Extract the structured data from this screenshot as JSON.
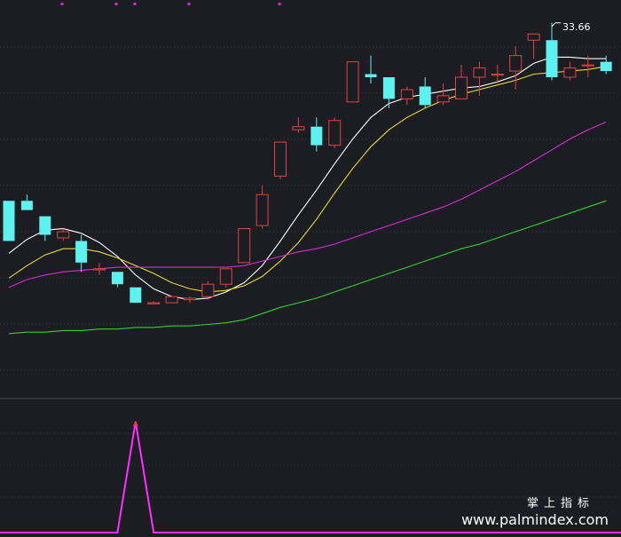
{
  "watermark": {
    "cn": "掌上指标",
    "url": "www.palmindex.com"
  },
  "colors": {
    "background": "#1c1d22",
    "grid": "#30323a",
    "up_candle": "#e0433f",
    "down_candle": "#5ff0f0",
    "ma_short": "#ffffff",
    "ma_mid": "#e6d833",
    "ma_long": "#d32bd3",
    "ma_longest": "#2fd12f",
    "indicator": "#ff30ff",
    "top_marker": "#e01ee0"
  },
  "chart_data": [
    {
      "type": "candlestick",
      "title": "",
      "xlabel": "",
      "ylabel": "",
      "ylim": [
        21.5,
        34.4
      ],
      "grid": true,
      "annotations": [
        {
          "text": "33.66",
          "index": 30,
          "value": 33.66
        }
      ],
      "candles": [
        {
          "o": 27.9,
          "h": 27.9,
          "c": 26.6,
          "l": 26.6
        },
        {
          "o": 27.9,
          "h": 28.1,
          "c": 27.6,
          "l": 27.6
        },
        {
          "o": 27.4,
          "h": 27.4,
          "c": 26.8,
          "l": 26.6
        },
        {
          "o": 26.7,
          "h": 27.0,
          "c": 26.9,
          "l": 26.6
        },
        {
          "o": 26.6,
          "h": 26.8,
          "c": 25.9,
          "l": 25.6
        },
        {
          "o": 25.7,
          "h": 25.9,
          "c": 25.7,
          "l": 25.5
        },
        {
          "o": 25.6,
          "h": 25.6,
          "c": 25.2,
          "l": 25.1
        },
        {
          "o": 25.1,
          "h": 25.1,
          "c": 24.6,
          "l": 24.6
        },
        {
          "o": 24.6,
          "h": 24.65,
          "c": 24.6,
          "l": 24.55
        },
        {
          "o": 24.6,
          "h": 24.8,
          "c": 24.8,
          "l": 24.6
        },
        {
          "o": 24.7,
          "h": 24.8,
          "c": 24.75,
          "l": 24.6
        },
        {
          "o": 24.8,
          "h": 25.3,
          "c": 25.2,
          "l": 24.7
        },
        {
          "o": 25.2,
          "h": 25.7,
          "c": 25.7,
          "l": 25.1
        },
        {
          "o": 25.9,
          "h": 27.0,
          "c": 27.0,
          "l": 25.9
        },
        {
          "o": 27.1,
          "h": 28.4,
          "c": 28.1,
          "l": 27.0
        },
        {
          "o": 28.7,
          "h": 29.8,
          "c": 29.8,
          "l": 28.6
        },
        {
          "o": 30.2,
          "h": 30.6,
          "c": 30.3,
          "l": 30.1
        },
        {
          "o": 30.3,
          "h": 30.6,
          "c": 29.7,
          "l": 29.5
        },
        {
          "o": 29.7,
          "h": 30.6,
          "c": 30.5,
          "l": 29.6
        },
        {
          "o": 31.1,
          "h": 32.4,
          "c": 32.4,
          "l": 31.1
        },
        {
          "o": 32.0,
          "h": 32.6,
          "c": 31.9,
          "l": 31.7
        },
        {
          "o": 31.9,
          "h": 31.9,
          "c": 31.2,
          "l": 30.9
        },
        {
          "o": 31.2,
          "h": 31.6,
          "c": 31.5,
          "l": 31.0
        },
        {
          "o": 31.6,
          "h": 31.9,
          "c": 31.0,
          "l": 30.9
        },
        {
          "o": 31.1,
          "h": 31.7,
          "c": 31.3,
          "l": 31.0
        },
        {
          "o": 31.2,
          "h": 32.3,
          "c": 31.9,
          "l": 31.2
        },
        {
          "o": 31.9,
          "h": 32.4,
          "c": 32.2,
          "l": 31.3
        },
        {
          "o": 32.0,
          "h": 32.3,
          "c": 32.0,
          "l": 31.7
        },
        {
          "o": 32.1,
          "h": 32.9,
          "c": 32.6,
          "l": 31.5
        },
        {
          "o": 33.1,
          "h": 33.3,
          "c": 33.3,
          "l": 32.5
        },
        {
          "o": 33.1,
          "h": 33.66,
          "c": 31.9,
          "l": 31.8
        },
        {
          "o": 31.9,
          "h": 32.4,
          "c": 32.2,
          "l": 31.8
        },
        {
          "o": 32.3,
          "h": 32.6,
          "c": 32.3,
          "l": 31.9
        },
        {
          "o": 32.4,
          "h": 32.6,
          "c": 32.1,
          "l": 32.0
        }
      ],
      "ma_lines": [
        {
          "key": "ma_short",
          "values": [
            26.2,
            26.65,
            26.95,
            27.0,
            26.85,
            26.55,
            26.1,
            25.5,
            25.05,
            24.8,
            24.7,
            24.75,
            24.95,
            25.25,
            25.8,
            26.6,
            27.45,
            28.25,
            29.1,
            29.9,
            30.6,
            31.05,
            31.25,
            31.35,
            31.45,
            31.55,
            31.6,
            31.75,
            31.95,
            32.35,
            32.55,
            32.55,
            32.5,
            32.5
          ]
        },
        {
          "key": "ma_mid",
          "values": [
            25.4,
            25.8,
            26.15,
            26.35,
            26.35,
            26.25,
            26.05,
            25.8,
            25.55,
            25.25,
            25.05,
            24.95,
            25.0,
            25.15,
            25.45,
            25.95,
            26.55,
            27.3,
            28.15,
            28.95,
            29.65,
            30.2,
            30.6,
            30.9,
            31.15,
            31.35,
            31.5,
            31.65,
            31.8,
            32.0,
            32.05,
            32.1,
            32.15,
            32.25
          ]
        },
        {
          "key": "ma_long",
          "values": [
            25.1,
            25.35,
            25.5,
            25.6,
            25.65,
            25.7,
            25.75,
            25.75,
            25.75,
            25.75,
            25.75,
            25.75,
            25.75,
            25.8,
            25.95,
            26.1,
            26.25,
            26.35,
            26.5,
            26.7,
            26.9,
            27.1,
            27.3,
            27.5,
            27.7,
            27.95,
            28.25,
            28.55,
            28.85,
            29.2,
            29.55,
            29.9,
            30.2,
            30.45
          ]
        },
        {
          "key": "ma_longest",
          "values": [
            23.6,
            23.65,
            23.65,
            23.7,
            23.7,
            23.75,
            23.75,
            23.8,
            23.8,
            23.85,
            23.85,
            23.9,
            23.95,
            24.05,
            24.25,
            24.45,
            24.6,
            24.75,
            24.95,
            25.15,
            25.35,
            25.55,
            25.75,
            25.95,
            26.15,
            26.35,
            26.5,
            26.7,
            26.9,
            27.1,
            27.3,
            27.5,
            27.7,
            27.9
          ]
        }
      ]
    },
    {
      "type": "line",
      "title": "",
      "xlabel": "",
      "ylabel": "",
      "ylim": [
        0,
        1
      ],
      "series": [
        {
          "values": [
            0,
            0,
            0,
            0,
            0,
            0,
            0,
            1,
            0,
            0,
            0,
            0,
            0,
            0,
            0,
            0,
            0,
            0,
            0,
            0,
            0,
            0,
            0,
            0,
            0,
            0,
            0,
            0,
            0,
            0,
            0,
            0,
            0,
            0
          ]
        }
      ]
    }
  ]
}
